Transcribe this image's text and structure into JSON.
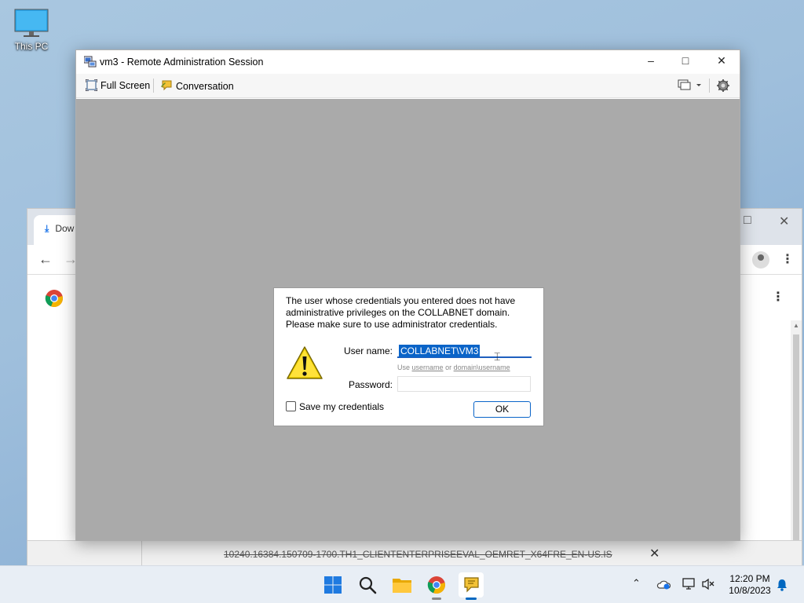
{
  "desktop": {
    "icon_label": "This PC"
  },
  "chrome": {
    "tab_label": "Dow",
    "download_filename": "10240.16384.150709-1700.TH1_CLIENTENTERPRISEEVAL_OEMRET_X64FRE_EN-US.IS"
  },
  "remote_window": {
    "title": "vm3 - Remote Administration Session",
    "toolbar": {
      "full_screen": "Full Screen",
      "conversation": "Conversation"
    }
  },
  "dialog": {
    "message": "The user whose credentials you entered does not have administrative privileges on the COLLABNET domain. Please make sure to use administrator credentials.",
    "username_label": "User name:",
    "username_value": "COLLABNET\\VM3",
    "hint_use": "Use",
    "hint_username": "username",
    "hint_or": "or",
    "hint_domain_username": "domain\\username",
    "password_label": "Password:",
    "password_value": "",
    "save_credentials_label": "Save my credentials",
    "save_credentials_checked": false,
    "ok_label": "OK"
  },
  "taskbar": {
    "time": "12:20 PM",
    "date": "10/8/2023",
    "accent": "#0067c0"
  }
}
